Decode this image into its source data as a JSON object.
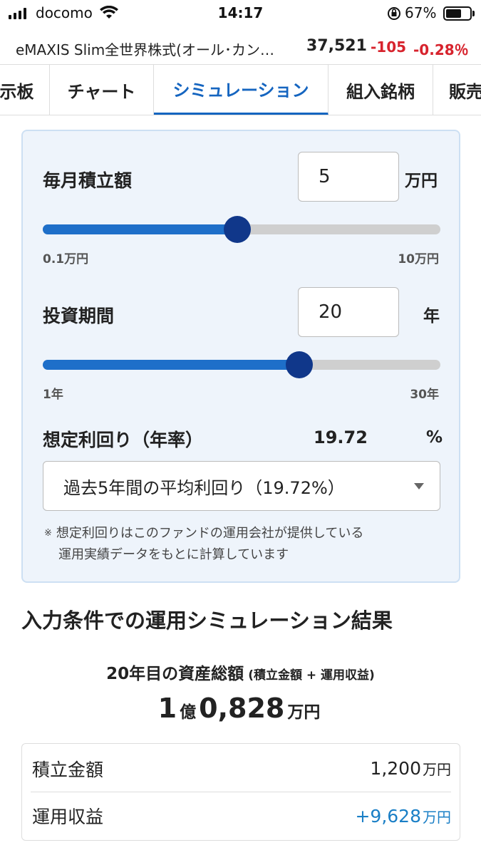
{
  "status_bar": {
    "carrier": "docomo",
    "time": "14:17",
    "battery_percent": "67%",
    "battery_level": 0.67,
    "icons": [
      "cellular-signal-icon",
      "wifi-icon",
      "rotation-lock-icon",
      "battery-icon"
    ]
  },
  "fund": {
    "name": "eMAXIS Slim全世界株式(オール･カン…",
    "price": "37,521",
    "change": "-105",
    "change_pct": "-0.28％"
  },
  "tabs": [
    {
      "label": "示板",
      "active": false
    },
    {
      "label": "チャート",
      "active": false
    },
    {
      "label": "シミュレーション",
      "active": true
    },
    {
      "label": "組入銘柄",
      "active": false
    },
    {
      "label": "販売",
      "active": false
    }
  ],
  "simulation": {
    "monthly": {
      "label": "毎月積立額",
      "value": "5",
      "unit": "万円",
      "min_label": "0.1万円",
      "max_label": "10万円",
      "slider_fraction": 0.49
    },
    "period": {
      "label": "投資期間",
      "value": "20",
      "unit": "年",
      "min_label": "1年",
      "max_label": "30年",
      "slider_fraction": 0.646
    },
    "yield": {
      "label": "想定利回り（年率）",
      "value": "19.72",
      "unit": "%",
      "select_value": "過去5年間の平均利回り（19.72%）"
    },
    "note": {
      "mark": "※",
      "line1": "想定利回りはこのファンドの運用会社が提供している",
      "line2": "運用実績データをもとに計算しています"
    }
  },
  "results": {
    "title": "入力条件での運用シミュレーション結果",
    "total_label": "20年目の資産総額",
    "total_sub": "(積立金額 + 運用収益)",
    "total_oku": "1",
    "total_oku_unit": "億",
    "total_man": "0,828",
    "total_man_unit": "万円",
    "rows": [
      {
        "label": "積立金額",
        "value": "1,200",
        "unit": "万円"
      },
      {
        "label": "運用収益",
        "value": "+9,628",
        "unit": "万円"
      }
    ]
  },
  "colors": {
    "accent": "#1565c0",
    "slider_fill": "#1e6fc9",
    "slider_thumb": "#10378a",
    "negative": "#d7232d",
    "positive": "#1a7fc6",
    "panel_bg": "#eef4fb"
  }
}
